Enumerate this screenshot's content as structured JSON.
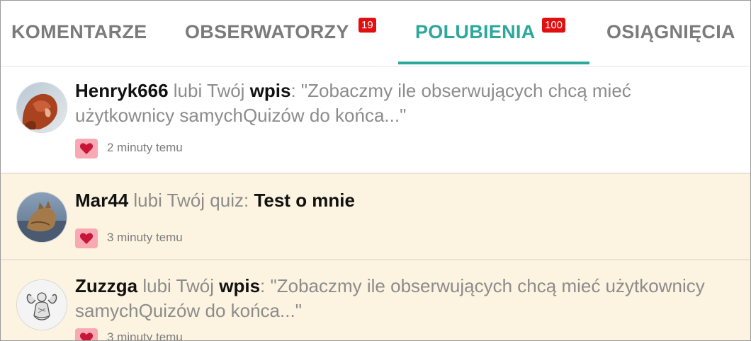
{
  "tabs": [
    {
      "label": "KOMENTARZE",
      "badge": ""
    },
    {
      "label": "OBSERWATORZY",
      "badge": "19"
    },
    {
      "label": "POLUBIENIA",
      "badge": "100"
    },
    {
      "label": "OSIĄGNIĘCIA",
      "badge": ""
    }
  ],
  "active_tab": "POLUBIENIA",
  "notifications": [
    {
      "user": "Henryk666",
      "action": " lubi Twój ",
      "object": "wpis",
      "detail": ": \"Zobaczmy ile obserwujących chcą mieć użytkownicy samychQuizów do końca...\"",
      "time": "2 minuty temu",
      "state": "read",
      "avatar_icon": "avatar-photo-red-hair"
    },
    {
      "user": "Mar44",
      "action": " lubi Twój quiz: ",
      "object": "Test o mnie",
      "detail": "",
      "time": "3 minuty temu",
      "state": "unread",
      "avatar_icon": "avatar-photo-cat"
    },
    {
      "user": "Zuzzga",
      "action": " lubi Twój ",
      "object": "wpis",
      "detail": ": \"Zobaczmy ile obserwujących chcą mieć użytkownicy samychQuizów do końca...\"",
      "time": "3 minuty temu",
      "state": "unread",
      "avatar_icon": "avatar-angel-drawing"
    }
  ],
  "colors": {
    "accent": "#2ba89b",
    "badge": "#e01010",
    "unread_bg": "#fdf3e1",
    "heart_bg": "#f7a9b4",
    "heart": "#c8163a"
  }
}
